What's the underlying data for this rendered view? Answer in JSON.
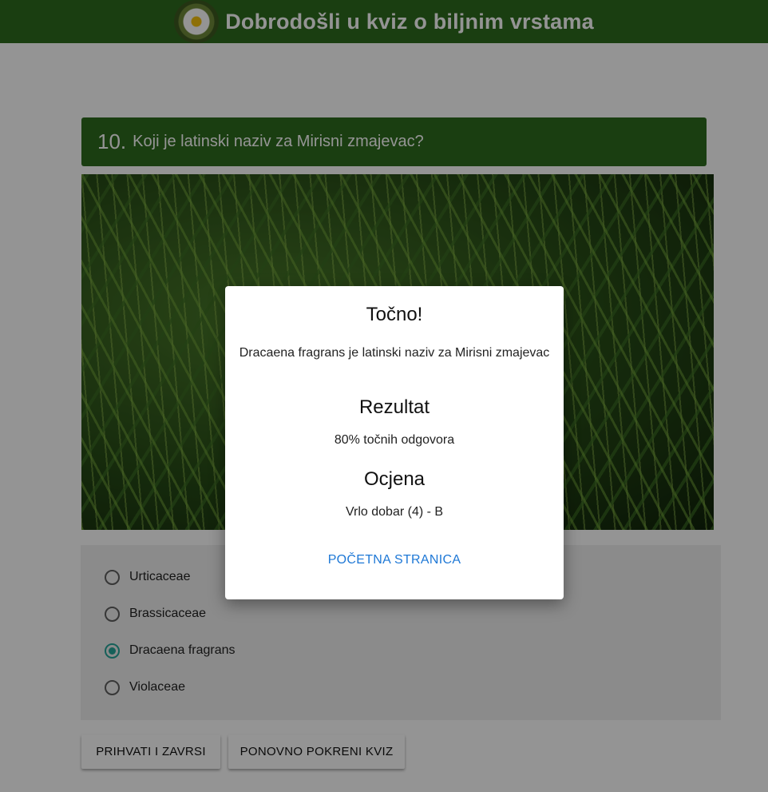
{
  "header": {
    "title": "Dobrodošli u kviz o biljnim vrstama",
    "logo_icon": "daisy-flower-icon"
  },
  "question": {
    "number": "10.",
    "text": "Koji je latinski naziv za Mirisni zmajevac?"
  },
  "answers": [
    {
      "label": "Urticaceae",
      "selected": false
    },
    {
      "label": "Brassicaceae",
      "selected": false
    },
    {
      "label": "Dracaena fragrans",
      "selected": true
    },
    {
      "label": "Violaceae",
      "selected": false
    }
  ],
  "buttons": {
    "accept_finish": "PRIHVATI I ZAVRSI",
    "restart": "PONOVNO POKRENI KVIZ"
  },
  "modal": {
    "title": "Točno!",
    "message": "Dracaena fragrans je latinski naziv za Mirisni zmajevac",
    "result_heading": "Rezultat",
    "result_value": "80% točnih odgovora",
    "grade_heading": "Ocjena",
    "grade_value": "Vrlo dobar (4) - B",
    "home_link": "POČETNA STRANICA"
  },
  "colors": {
    "header_bg": "#2e6b1e",
    "accent_radio": "#26a69a",
    "link": "#1e78d6"
  }
}
